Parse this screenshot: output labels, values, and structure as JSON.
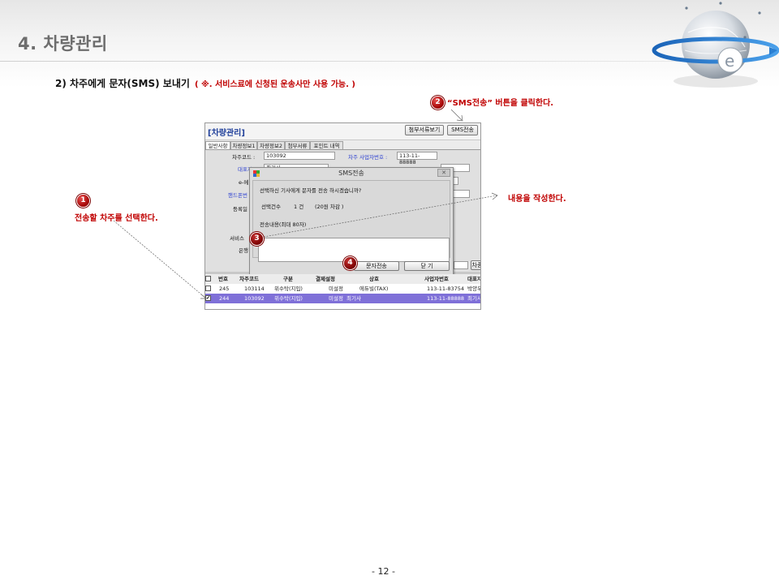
{
  "header": {
    "title": "4. 차량관리"
  },
  "section": {
    "title": "2) 차주에게 문자(SMS) 보내기",
    "note": "( ※. 서비스료에 신청된 운송사만 사용 가능. )"
  },
  "annotations": {
    "a1": {
      "number": "1",
      "text": "전송할 차주를 선택한다."
    },
    "a2": {
      "number": "2",
      "text": "“SMS전송” 버튼을 클릭한다."
    },
    "a3": {
      "number": "3",
      "text": "내용을 작성한다."
    },
    "a4": {
      "number": "4"
    }
  },
  "screenshot": {
    "title": "[차량관리]",
    "buttons": {
      "attach_view": "첨부서류보기",
      "sms_send": "SMS전송"
    },
    "tabs": [
      "일반사항",
      "차량정보1",
      "차량정보2",
      "첨부서류",
      "포인트 내역"
    ],
    "form": {
      "owner_code_label": "차주코드 :",
      "owner_code_value": "103092",
      "biz_no_label": "차주 사업자번호 :",
      "biz_no_value": "113-11-88888",
      "rep_label": "대표자",
      "rep_value": "최기사",
      "email_label": "e-메",
      "phone_label": "핸드폰번",
      "reg_label": "등록일",
      "service_label": "서비스",
      "bank_label": "은행",
      "extra_label": "차종"
    },
    "dialog": {
      "title": "SMS전송",
      "close": "✕",
      "question": "선택하신 기사에게 문자를 전송 하시겠습니까?",
      "count_label": "선택건수",
      "count_value": "1 건",
      "cost_note": "(20원 차감 )",
      "content_label": "전송내용(최대 80자)",
      "send_button": "문자전송",
      "close_button": "닫 기"
    },
    "grid": {
      "headers": [
        "번호",
        "차주코드",
        "구분",
        "결제설정",
        "상호",
        "사업자번호",
        "대표자"
      ],
      "rows": [
        {
          "checked": "",
          "no": "245",
          "code": "103114",
          "type": "위수탁(지입)",
          "setting": "미설정",
          "company": "에듀빌(TAX)",
          "biz_no": "113-11-83754",
          "rep": "박양우"
        },
        {
          "checked": "✔",
          "no": "244",
          "code": "103092",
          "type": "위수탁(지입)",
          "setting": "미설정",
          "company": "최기사",
          "biz_no": "113-11-88888",
          "rep": "최기사"
        }
      ]
    }
  },
  "footer": {
    "page_number": "- 12 -"
  },
  "colors": {
    "accent_red": "#c00000",
    "title_gray": "#6d6d6d",
    "selected_row": "#7f70d8",
    "form_blue": "#2b3fd0"
  }
}
